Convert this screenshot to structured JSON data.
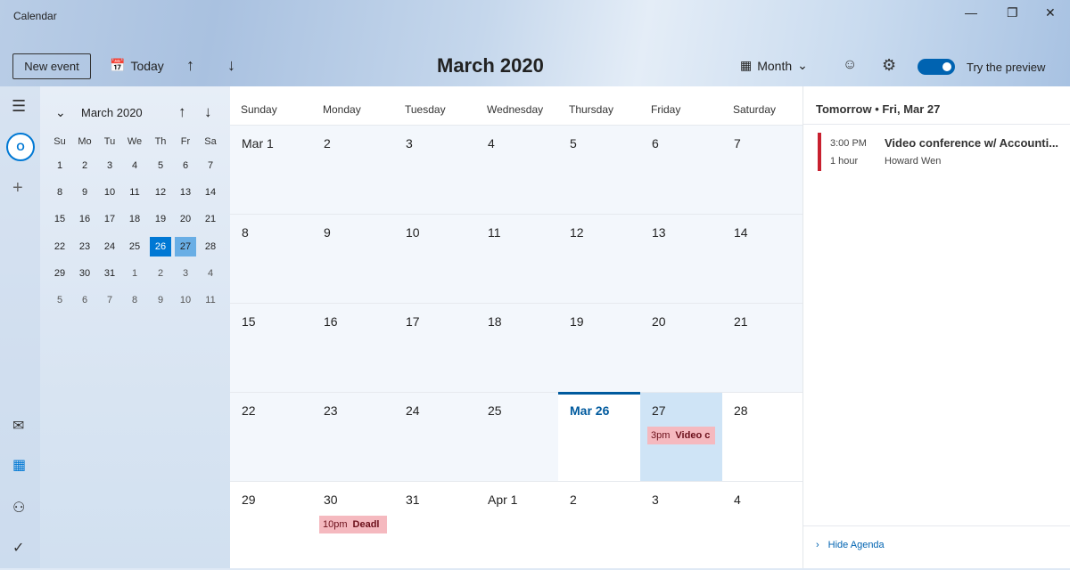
{
  "app": {
    "title": "Calendar"
  },
  "toolbar": {
    "new_event": "New event",
    "today": "Today",
    "month_title": "March 2020",
    "view": "Month",
    "preview_label": "Try the preview",
    "preview_on": true
  },
  "mini": {
    "title": "March 2020",
    "weekdays": [
      "Su",
      "Mo",
      "Tu",
      "We",
      "Th",
      "Fr",
      "Sa"
    ],
    "weeks": [
      [
        "1",
        "2",
        "3",
        "4",
        "5",
        "6",
        "7"
      ],
      [
        "8",
        "9",
        "10",
        "11",
        "12",
        "13",
        "14"
      ],
      [
        "15",
        "16",
        "17",
        "18",
        "19",
        "20",
        "21"
      ],
      [
        "22",
        "23",
        "24",
        "25",
        "26",
        "27",
        "28"
      ],
      [
        "29",
        "30",
        "31",
        "1",
        "2",
        "3",
        "4"
      ],
      [
        "5",
        "6",
        "7",
        "8",
        "9",
        "10",
        "11"
      ]
    ]
  },
  "grid": {
    "weekdays": [
      "Sunday",
      "Monday",
      "Tuesday",
      "Wednesday",
      "Thursday",
      "Friday",
      "Saturday"
    ],
    "weeks": [
      [
        "Mar 1",
        "2",
        "3",
        "4",
        "5",
        "6",
        "7"
      ],
      [
        "8",
        "9",
        "10",
        "11",
        "12",
        "13",
        "14"
      ],
      [
        "15",
        "16",
        "17",
        "18",
        "19",
        "20",
        "21"
      ],
      [
        "22",
        "23",
        "24",
        "25",
        "Mar 26",
        "27",
        "28"
      ],
      [
        "29",
        "30",
        "31",
        "Apr 1",
        "2",
        "3",
        "4"
      ]
    ],
    "events": [
      {
        "week": 3,
        "day": 5,
        "time": "3pm",
        "title": "Video c"
      },
      {
        "week": 4,
        "day": 1,
        "time": "10pm",
        "title": "Deadl"
      }
    ]
  },
  "agenda": {
    "heading": "Tomorrow • Fri, Mar 27",
    "event": {
      "time": "3:00 PM",
      "duration": "1 hour",
      "title": "Video conference w/ Accounti...",
      "organizer": "Howard Wen"
    },
    "hide": "Hide Agenda"
  },
  "colors": {
    "accent": "#0078d4",
    "today": "#005a9e",
    "event": "#f5b9bf",
    "event_bar": "#c8202f"
  }
}
